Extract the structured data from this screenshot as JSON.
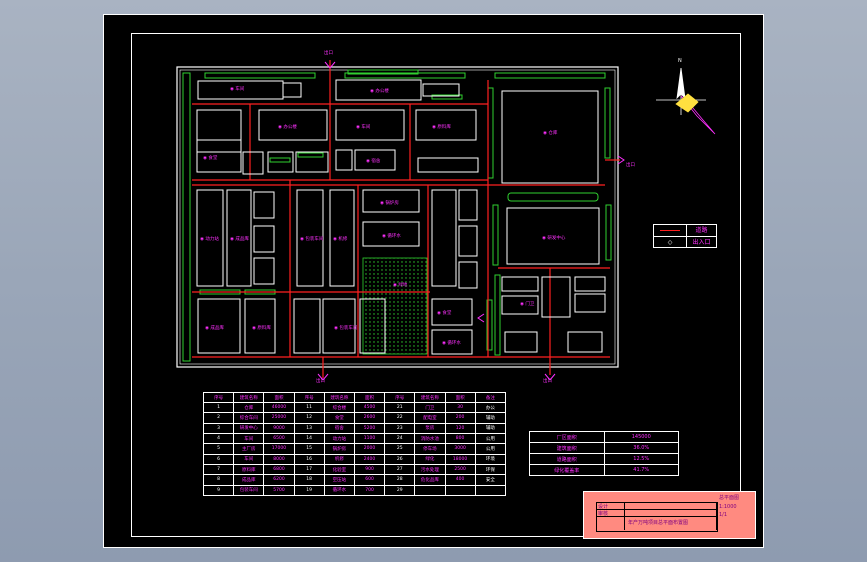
{
  "drawing": {
    "site_entrances": [
      "出口",
      "出口",
      "出口",
      "出口"
    ],
    "north_arrow_label": "N",
    "colors": {
      "background": "#000000",
      "building": "#ffffff",
      "road": "#ff2020",
      "greenery": "#30d030",
      "label": "#ff30ff",
      "title_block": "#ff8a80"
    }
  },
  "legend": {
    "rows": [
      {
        "symbol": "road",
        "label": "道路"
      },
      {
        "symbol": "entrance",
        "label": "出入口"
      }
    ]
  },
  "building_table": {
    "headers": [
      "序号",
      "建筑名称",
      "面积",
      "序号",
      "建筑名称",
      "面积",
      "序号",
      "建筑名称",
      "面积",
      "备注"
    ],
    "rows": [
      [
        "1",
        "仓库",
        "46000",
        "11",
        "综合楼",
        "4500",
        "21",
        "门卫",
        "30",
        "办公"
      ],
      [
        "2",
        "综合车间",
        "25000",
        "12",
        "食堂",
        "2600",
        "22",
        "配电室",
        "200",
        "辅助"
      ],
      [
        "3",
        "研发中心",
        "9000",
        "13",
        "宿舍",
        "5200",
        "23",
        "泵房",
        "120",
        "辅助"
      ],
      [
        "4",
        "车间",
        "6500",
        "14",
        "动力站",
        "1100",
        "24",
        "消防水池",
        "800",
        "公用"
      ],
      [
        "5",
        "主厂房",
        "17000",
        "15",
        "锅炉房",
        "2000",
        "25",
        "停车场",
        "3000",
        "公用"
      ],
      [
        "6",
        "车间",
        "8000",
        "16",
        "机修",
        "2400",
        "26",
        "绿化",
        "18000",
        "环境"
      ],
      [
        "7",
        "原料库",
        "6800",
        "17",
        "化验室",
        "900",
        "27",
        "污水处理",
        "2500",
        "环保"
      ],
      [
        "8",
        "成品库",
        "6200",
        "18",
        "空压站",
        "600",
        "28",
        "危化品库",
        "400",
        "安全"
      ],
      [
        "9",
        "包装车间",
        "5700",
        "19",
        "循环水",
        "700",
        "29",
        "",
        "",
        ""
      ]
    ]
  },
  "summary_table": {
    "rows": [
      {
        "label": "厂区面积",
        "value": "145000"
      },
      {
        "label": "建筑面积",
        "value": "36.0%"
      },
      {
        "label": "道路面积",
        "value": "12.5%"
      },
      {
        "label": "绿化覆盖率",
        "value": "41.7%"
      }
    ]
  },
  "title_block": {
    "project": "总平面图",
    "scale": "1:1000",
    "sheet": "1/1",
    "drawing_title": "年产万吨项目总平面布置图",
    "designer": "设计",
    "checker": "审核"
  },
  "labels": {
    "warehouse": "仓库",
    "workshop": "车间",
    "office": "办公楼",
    "lab": "研发中心",
    "canteen": "食堂",
    "dorm": "宿舍",
    "power": "动力站",
    "boiler": "锅炉房",
    "green": "绿地",
    "store": "原料库",
    "product": "成品库",
    "pack": "包装车间",
    "repair": "机修",
    "water": "循环水",
    "gate": "门卫"
  }
}
